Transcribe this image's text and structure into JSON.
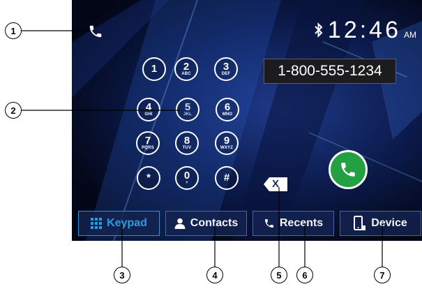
{
  "status": {
    "bluetooth_icon": "bluetooth-icon",
    "time": "12:46",
    "ampm": "AM"
  },
  "dialed_number": "1-800-555-1234",
  "keypad": [
    {
      "digit": "1",
      "letters": ""
    },
    {
      "digit": "2",
      "letters": "ABC"
    },
    {
      "digit": "3",
      "letters": "DEF"
    },
    {
      "digit": "4",
      "letters": "GHI"
    },
    {
      "digit": "5",
      "letters": "JKL"
    },
    {
      "digit": "6",
      "letters": "MNO"
    },
    {
      "digit": "7",
      "letters": "PQRS"
    },
    {
      "digit": "8",
      "letters": "TUV"
    },
    {
      "digit": "9",
      "letters": "WXYZ"
    },
    {
      "digit": "*",
      "letters": ""
    },
    {
      "digit": "0",
      "letters": "+"
    },
    {
      "digit": "#",
      "letters": ""
    }
  ],
  "backspace_label": "X",
  "tabs": [
    {
      "label": "Keypad",
      "icon": "grid-icon",
      "active": true
    },
    {
      "label": "Contacts",
      "icon": "person-icon",
      "active": false
    },
    {
      "label": "Recents",
      "icon": "phone-icon",
      "active": false
    },
    {
      "label": "Device",
      "icon": "mobile-device-icon",
      "active": false
    }
  ],
  "callouts": [
    "1",
    "2",
    "3",
    "4",
    "5",
    "6",
    "7"
  ],
  "colors": {
    "call_button": "#23a042",
    "active_tab": "#2e9be0",
    "screen_bg": "#0b1a4a"
  }
}
